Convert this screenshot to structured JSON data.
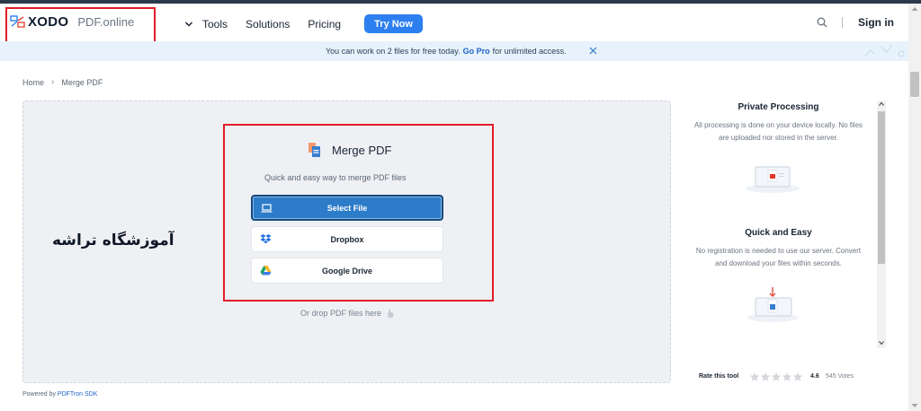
{
  "header": {
    "logo_text": "XODO",
    "logo_suffix": "PDF.online",
    "nav": {
      "tools": "Tools",
      "solutions": "Solutions",
      "pricing": "Pricing",
      "try_now": "Try Now"
    },
    "sign_in": "Sign in"
  },
  "banner": {
    "text_before": "You can work on 2 files for free today.",
    "go_pro": "Go Pro",
    "text_after": "for unlimited access."
  },
  "breadcrumb": {
    "home": "Home",
    "separator": "›",
    "current": "Merge PDF"
  },
  "overlay_text": "آموزشگاه تراشه",
  "tool": {
    "title": "Merge PDF",
    "subtitle": "Quick and easy way to merge PDF files",
    "buttons": {
      "select_file": "Select File",
      "dropbox": "Dropbox",
      "google_drive": "Google Drive"
    },
    "drop_hint": "Or drop PDF files here"
  },
  "panel": {
    "private": {
      "title": "Private Processing",
      "text": "All processing is done on your device locally. No files are uploaded nor stored in the server."
    },
    "quick": {
      "title": "Quick and Easy",
      "text": "No registration is needed to use our server. Convert and download your files within seconds."
    },
    "rating": {
      "label": "Rate this tool",
      "stars": 5,
      "score": "4.6",
      "votes": "545 Votes"
    }
  },
  "footer": {
    "powered_prefix": "Powered by",
    "powered_link": "PDFTron SDK"
  },
  "colors": {
    "accent": "#2d7ff0",
    "select_button": "#2d7cc9",
    "highlight_frame": "#e11d2a",
    "banner_bg": "#e7f2fc"
  }
}
